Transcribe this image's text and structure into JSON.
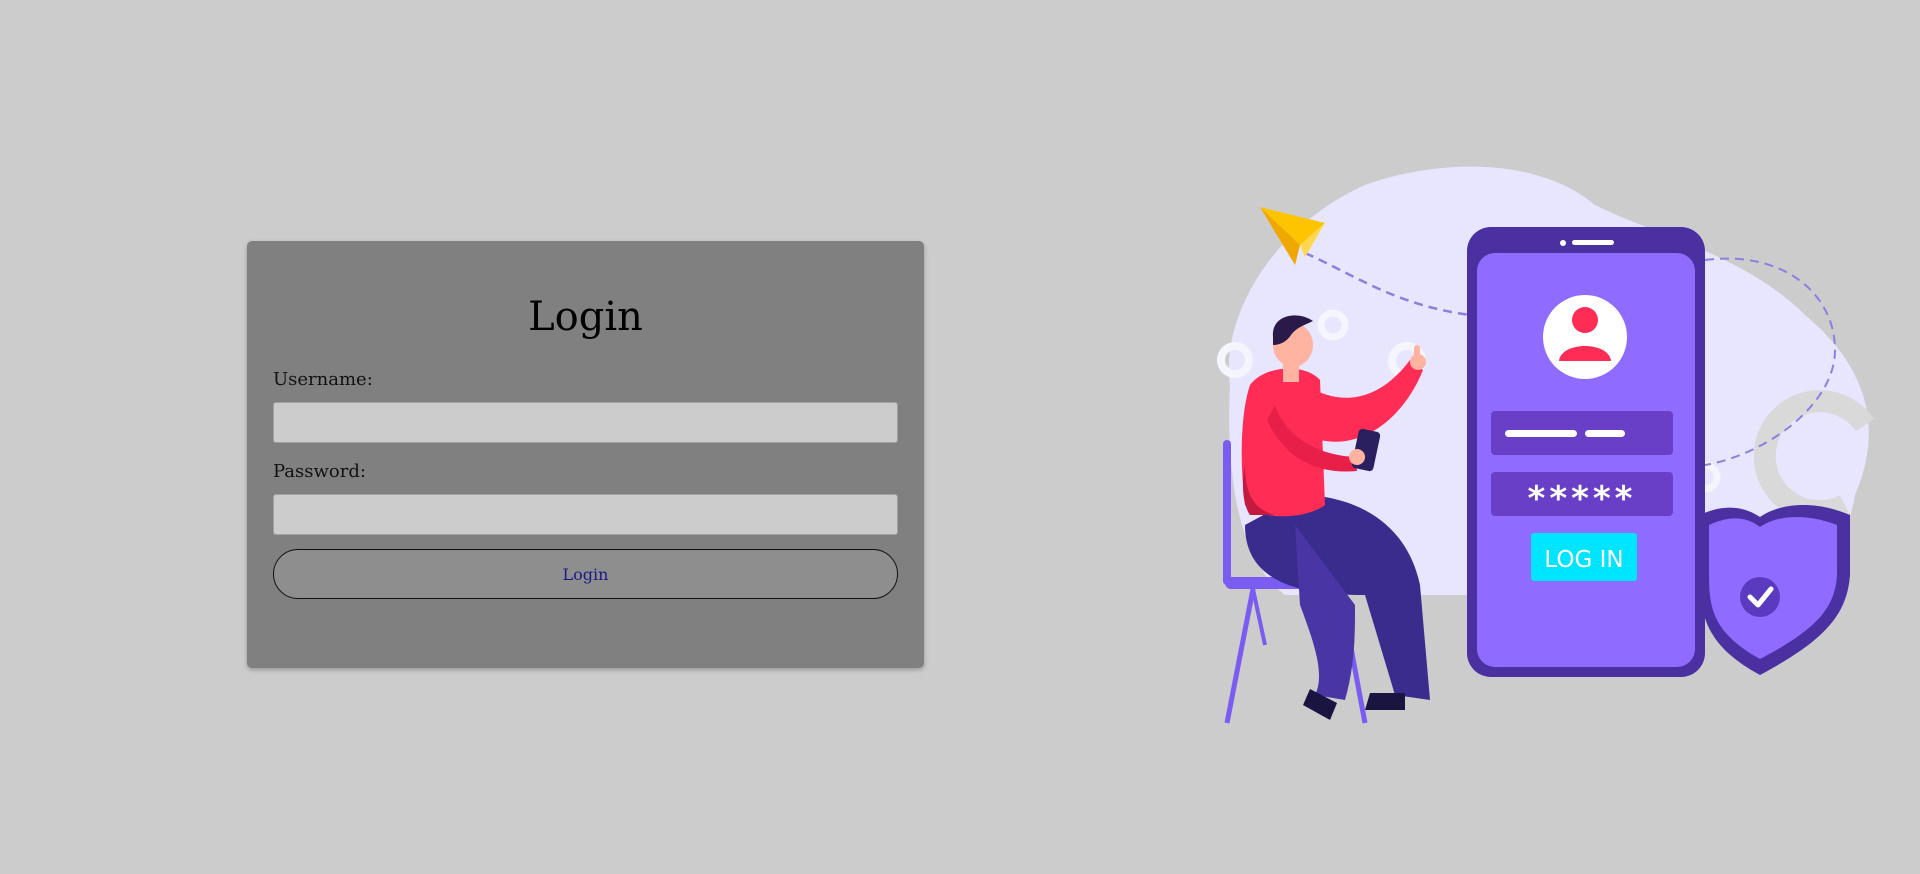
{
  "login_form": {
    "title": "Login",
    "username_label": "Username:",
    "username_value": "",
    "password_label": "Password:",
    "password_value": "",
    "submit_label": "Login"
  },
  "illustration": {
    "phone_login_label": "LOG IN",
    "phone_password_mask": "*****",
    "icons": [
      "user-avatar-icon",
      "shield-check-icon",
      "paper-plane-icon"
    ]
  },
  "colors": {
    "background": "#cccccc",
    "card": "#808080",
    "input": "#cccccc",
    "button_text": "#1a1a8a",
    "phone": "#8f6cff",
    "phone_dark": "#4a30a0",
    "accent_red": "#ff2d55",
    "accent_cyan": "#00e5ff"
  }
}
